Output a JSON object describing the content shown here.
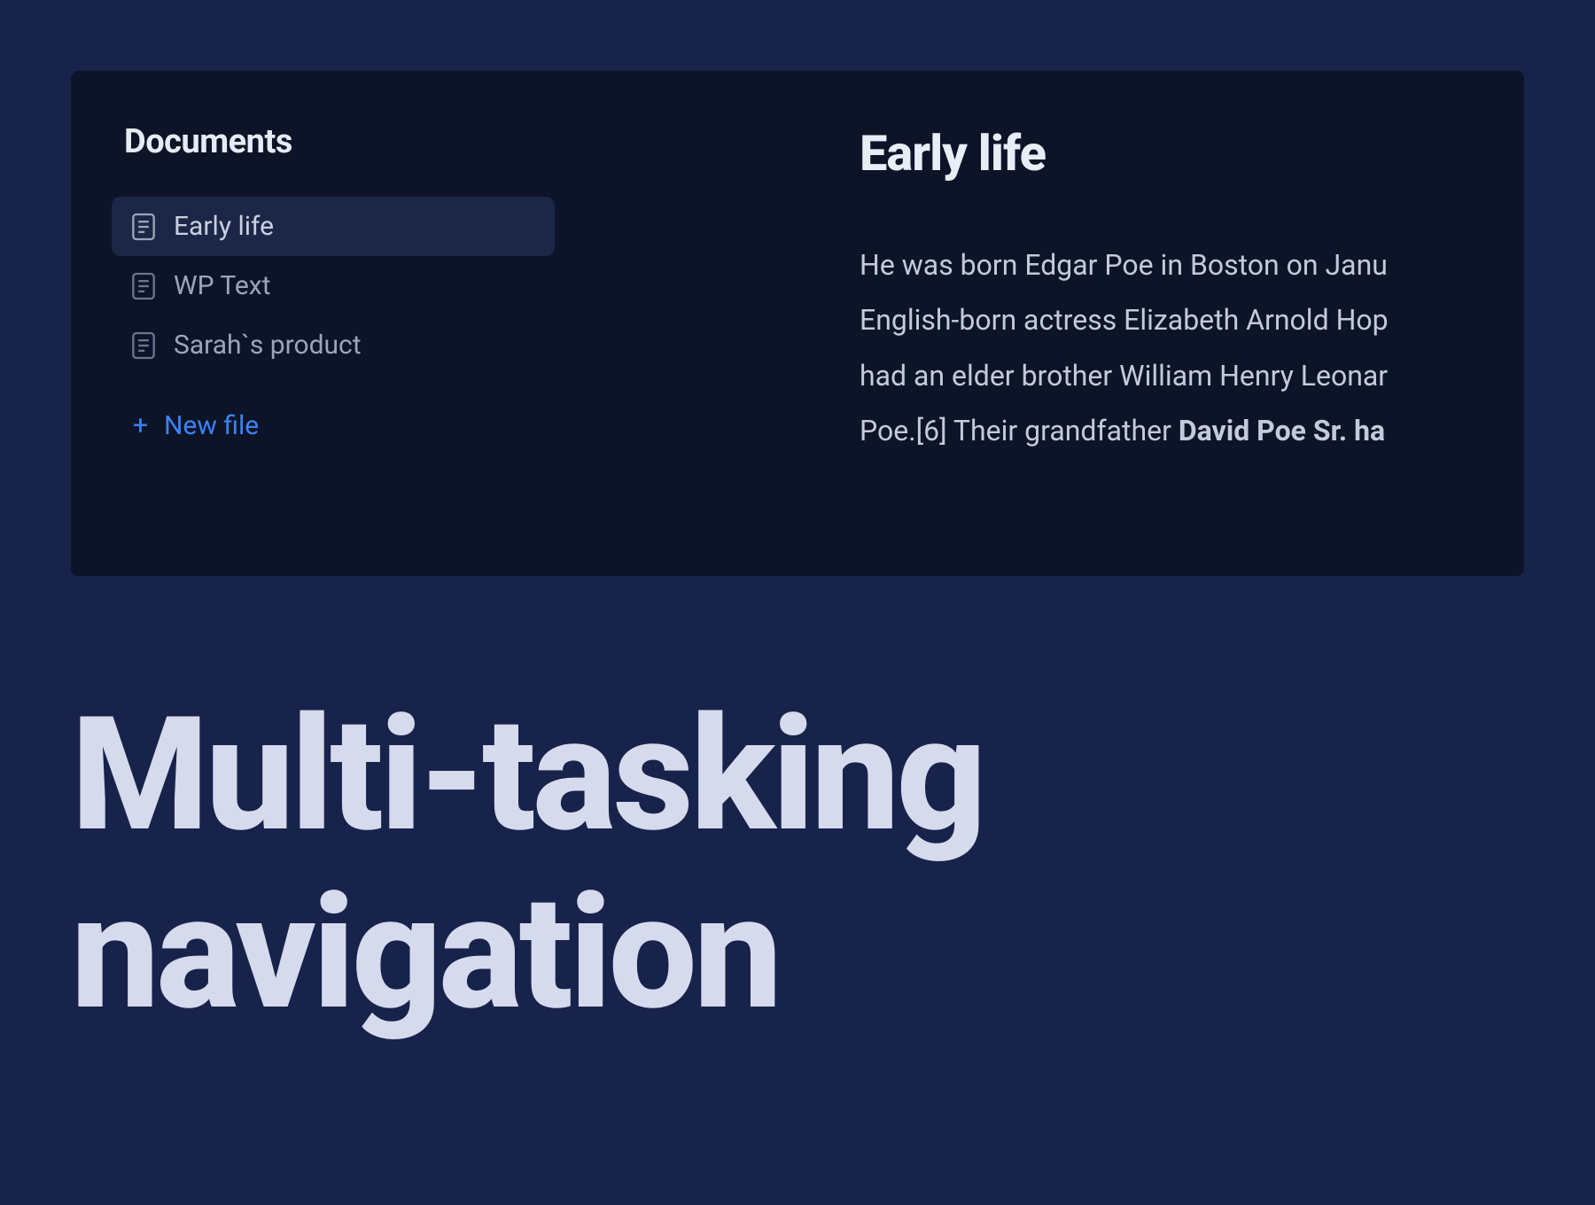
{
  "sidebar": {
    "title": "Documents",
    "items": [
      {
        "label": "Early life",
        "active": true
      },
      {
        "label": "WP Text",
        "active": false
      },
      {
        "label": "Sarah`s product",
        "active": false
      }
    ],
    "new_file_label": "New file"
  },
  "content": {
    "title": "Early life",
    "body_line1": "He was born Edgar Poe in Boston on Janu",
    "body_line2": "English-born actress Elizabeth Arnold Hop",
    "body_line3": "had an elder brother William Henry Leonar",
    "body_line4_pre": "Poe.[6] Their grandfather ",
    "body_line4_strong": "David Poe Sr. ha"
  },
  "hero": {
    "title_line1": "Multi-tasking",
    "title_line2": "navigation"
  }
}
